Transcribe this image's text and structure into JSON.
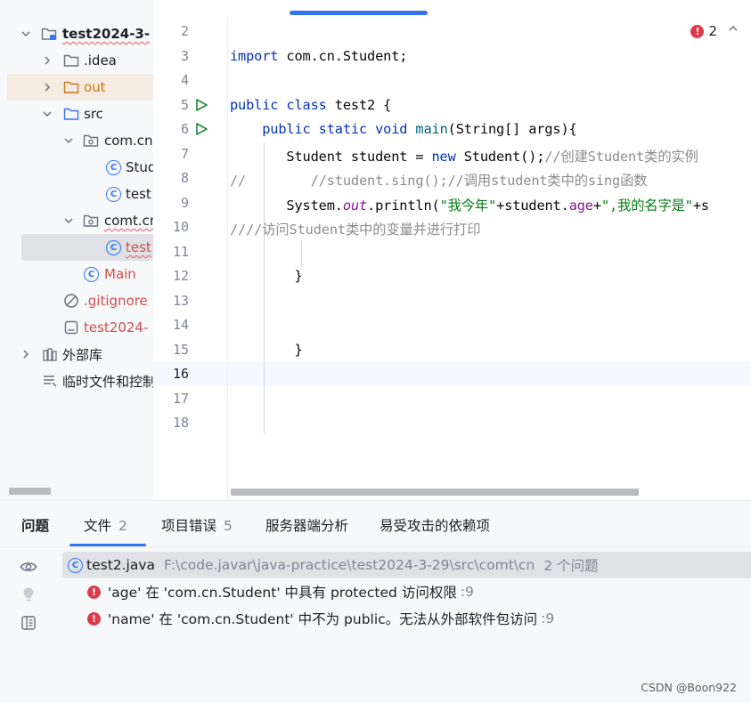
{
  "project_tree": {
    "root": {
      "label": "test2024-3-",
      "chevron": "chevron-down-icon",
      "icon": "module-folder-icon"
    },
    "items": [
      {
        "label": ".idea",
        "icon": "folder-icon",
        "chevron": "chevron-right-icon"
      },
      {
        "label": "out",
        "icon": "folder-icon",
        "chevron": "chevron-right-icon"
      },
      {
        "label": "src",
        "icon": "source-folder-icon",
        "chevron": "chevron-down-icon"
      },
      {
        "label": "com.cn",
        "icon": "package-icon",
        "chevron": "chevron-down-icon"
      },
      {
        "label": "Stud",
        "icon": "class-icon",
        "icon_glyph": "C"
      },
      {
        "label": "test",
        "icon": "class-icon",
        "icon_glyph": "C"
      },
      {
        "label": "comt.cn",
        "icon": "package-icon",
        "chevron": "chevron-down-icon"
      },
      {
        "label": "test",
        "icon": "class-icon",
        "icon_glyph": "C"
      },
      {
        "label": "Main",
        "icon": "class-icon",
        "icon_glyph": "C"
      },
      {
        "label": ".gitignore",
        "icon": "ignore-file-icon"
      },
      {
        "label": "test2024-",
        "icon": "iml-file-icon"
      },
      {
        "label": "外部库",
        "icon": "library-icon",
        "chevron": "chevron-right-icon"
      },
      {
        "label": "临时文件和控制",
        "icon": "scratches-icon"
      }
    ]
  },
  "editor": {
    "error_count": "2",
    "line_numbers": [
      "2",
      "3",
      "4",
      "5",
      "6",
      "7",
      "8",
      "9",
      "10",
      "11",
      "12",
      "13",
      "14",
      "15",
      "16",
      "17",
      "18"
    ],
    "current_line": "16",
    "code": {
      "l3_kw": "import",
      "l3_rest": " com.cn.Student;",
      "l5_kw1": "public",
      "l5_kw2": "class",
      "l5_rest": " test2 {",
      "l6_kw1": "public",
      "l6_kw2": "static",
      "l6_kw3": "void",
      "l6_fn": "main",
      "l6_rest": "(String[] args){",
      "l7_a": "Student student = ",
      "l7_kw": "new",
      "l7_b": " Student();",
      "l7_cmt": "//创建Student类的实例",
      "l8_cmt": "//        //student.sing();//调用student类中的sing函数",
      "l9_a": "System.",
      "l9_out": "out",
      "l9_b": ".println(",
      "l9_s1": "\"我今年\"",
      "l9_c": "+student.",
      "l9_fld": "age",
      "l9_d": "+",
      "l9_s2": "\",我的名字是\"",
      "l9_e": "+s",
      "l10_cmt": "////访问Student类中的变量并进行打印",
      "l12": "}",
      "l15": "}"
    }
  },
  "problems_panel": {
    "tabs": [
      {
        "label": "问题"
      },
      {
        "label": "文件",
        "count": "2"
      },
      {
        "label": "项目错误",
        "count": "5"
      },
      {
        "label": "服务器端分析"
      },
      {
        "label": "易受攻击的依赖项"
      }
    ],
    "file": {
      "name": "test2.java",
      "path": "F:\\code.javar\\java-practice\\test2024-3-29\\src\\comt\\cn",
      "count": "2 个问题"
    },
    "errors": [
      {
        "text": "'age' 在 'com.cn.Student' 中具有 protected 访问权限",
        "line": ":9"
      },
      {
        "text": "'name' 在 'com.cn.Student' 中不为 public。无法从外部软件包访问",
        "line": ":9"
      }
    ]
  },
  "watermark": "CSDN @Boon922",
  "colors": {
    "accent": "#3574f0",
    "error": "#db3b4b",
    "keyword": "#0033b3",
    "string": "#067d17",
    "comment": "#8c8c8c"
  }
}
